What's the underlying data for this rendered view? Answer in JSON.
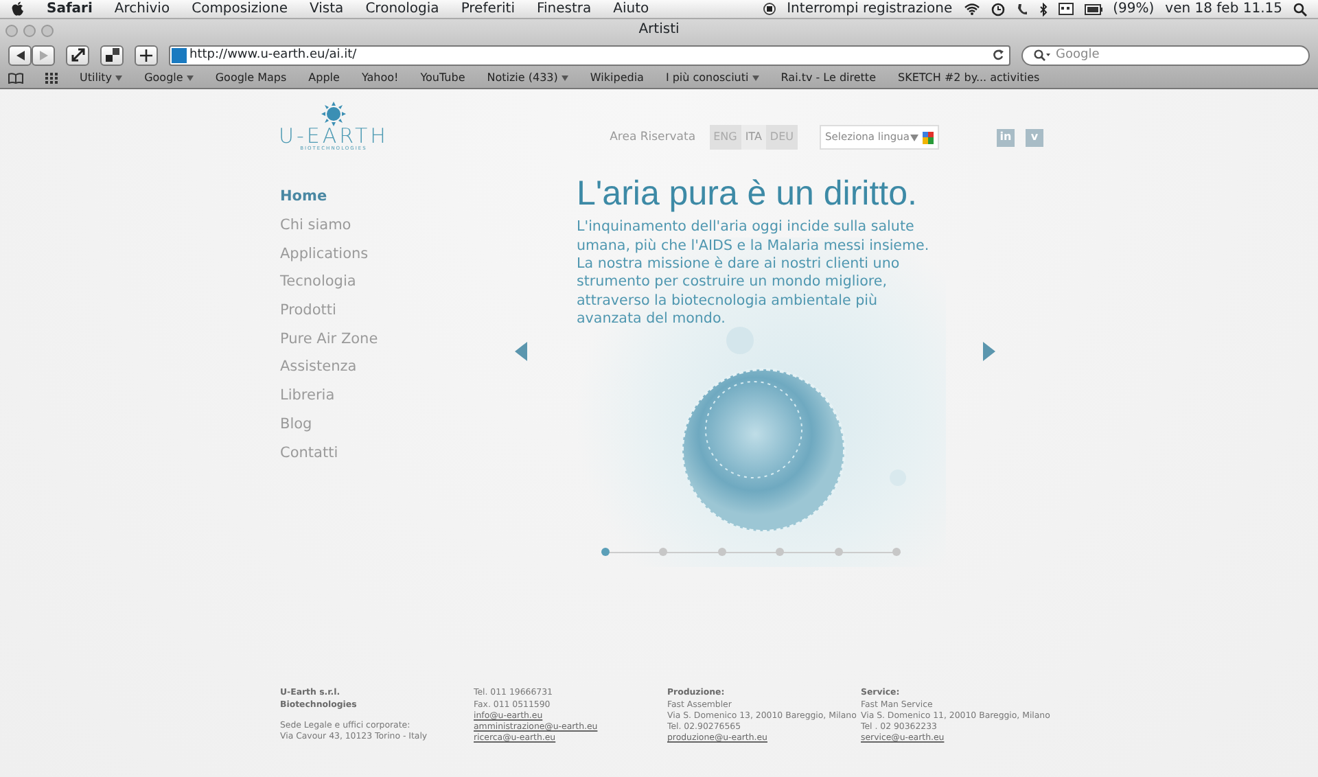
{
  "menubar": {
    "app": "Safari",
    "menus": [
      "Archivio",
      "Composizione",
      "Vista",
      "Cronologia",
      "Preferiti",
      "Finestra",
      "Aiuto"
    ],
    "recording": "Interrompi registrazione",
    "battery": "(99%)",
    "clock": "ven 18 feb  11.15"
  },
  "window": {
    "title": "Artisti"
  },
  "browser": {
    "url": "http://www.u-earth.eu/ai.it/",
    "search": {
      "placeholder": "Google"
    },
    "bookmarks": [
      {
        "label": "Utility",
        "dropdown": true
      },
      {
        "label": "Google",
        "dropdown": true
      },
      {
        "label": "Google Maps",
        "dropdown": false
      },
      {
        "label": "Apple",
        "dropdown": false
      },
      {
        "label": "Yahoo!",
        "dropdown": false
      },
      {
        "label": "YouTube",
        "dropdown": false
      },
      {
        "label": "Notizie (433)",
        "dropdown": true
      },
      {
        "label": "Wikipedia",
        "dropdown": false
      },
      {
        "label": "I più conosciuti",
        "dropdown": true
      },
      {
        "label": "Rai.tv - Le dirette",
        "dropdown": false
      },
      {
        "label": "SKETCH #2 by... activities",
        "dropdown": false
      }
    ]
  },
  "site": {
    "logo": {
      "name": "U-EARTH",
      "tagline": "BIOTECHNOLOGIES"
    },
    "reserved_area": "Area Riservata",
    "languages": [
      {
        "label": "ENG",
        "selected": false
      },
      {
        "label": "ITA",
        "selected": true
      },
      {
        "label": "DEU",
        "selected": false
      }
    ],
    "language_select": {
      "placeholder": "Seleziona lingua"
    },
    "social": [
      {
        "label": "in"
      },
      {
        "label": "v"
      }
    ],
    "nav": [
      {
        "label": "Home",
        "selected": true
      },
      {
        "label": "Chi siamo",
        "selected": false
      },
      {
        "label": "Applications",
        "selected": false
      },
      {
        "label": "Tecnologia",
        "selected": false
      },
      {
        "label": "Prodotti",
        "selected": false
      },
      {
        "label": "Pure Air Zone",
        "selected": false
      },
      {
        "label": "Assistenza",
        "selected": false
      },
      {
        "label": "Libreria",
        "selected": false
      },
      {
        "label": "Blog",
        "selected": false
      },
      {
        "label": "Contatti",
        "selected": false
      }
    ],
    "hero": {
      "title": "L'aria pura è un diritto.",
      "text": "L'inquinamento dell'aria oggi incide sulla salute umana, più che l'AIDS e la Malaria messi insieme. La nostra missione è dare ai nostri clienti uno strumento per costruire un mondo migliore, attraverso la biotecnologia ambientale più avanzata del mondo.",
      "dots": [
        {
          "selected": true
        },
        {
          "selected": false
        },
        {
          "selected": false
        },
        {
          "selected": false
        },
        {
          "selected": false
        },
        {
          "selected": false
        }
      ]
    },
    "footer": [
      [
        {
          "kind": "heading",
          "text": "U-Earth s.r.l."
        },
        {
          "kind": "heading",
          "text": "Biotechnologies"
        },
        {
          "kind": "note",
          "text": "Sede Legale e uffici corporate:"
        },
        {
          "kind": "text",
          "text": "Via Cavour 43, 10123 Torino - Italy"
        }
      ],
      [
        {
          "kind": "text",
          "text": "Tel. 011 19666731"
        },
        {
          "kind": "text",
          "text": "Fax. 011 0511590"
        },
        {
          "kind": "link",
          "text": "info@u-earth.eu"
        },
        {
          "kind": "link",
          "text": "amministrazione@u-earth.eu"
        },
        {
          "kind": "link",
          "text": "ricerca@u-earth.eu"
        }
      ],
      [
        {
          "kind": "heading",
          "text": "Produzione:"
        },
        {
          "kind": "text",
          "text": "Fast Assembler"
        },
        {
          "kind": "text",
          "text": "Via S. Domenico 13, 20010 Bareggio, Milano"
        },
        {
          "kind": "text",
          "text": "Tel. 02.90276565"
        },
        {
          "kind": "link",
          "text": "produzione@u-earth.eu"
        }
      ],
      [
        {
          "kind": "heading",
          "text": "Service:"
        },
        {
          "kind": "text",
          "text": "Fast Man Service"
        },
        {
          "kind": "text",
          "text": "Via S. Domenico 11, 20010 Bareggio, Milano"
        },
        {
          "kind": "text",
          "text": "Tel . 02 90362233"
        },
        {
          "kind": "link",
          "text": "service@u-earth.eu"
        }
      ]
    ]
  }
}
